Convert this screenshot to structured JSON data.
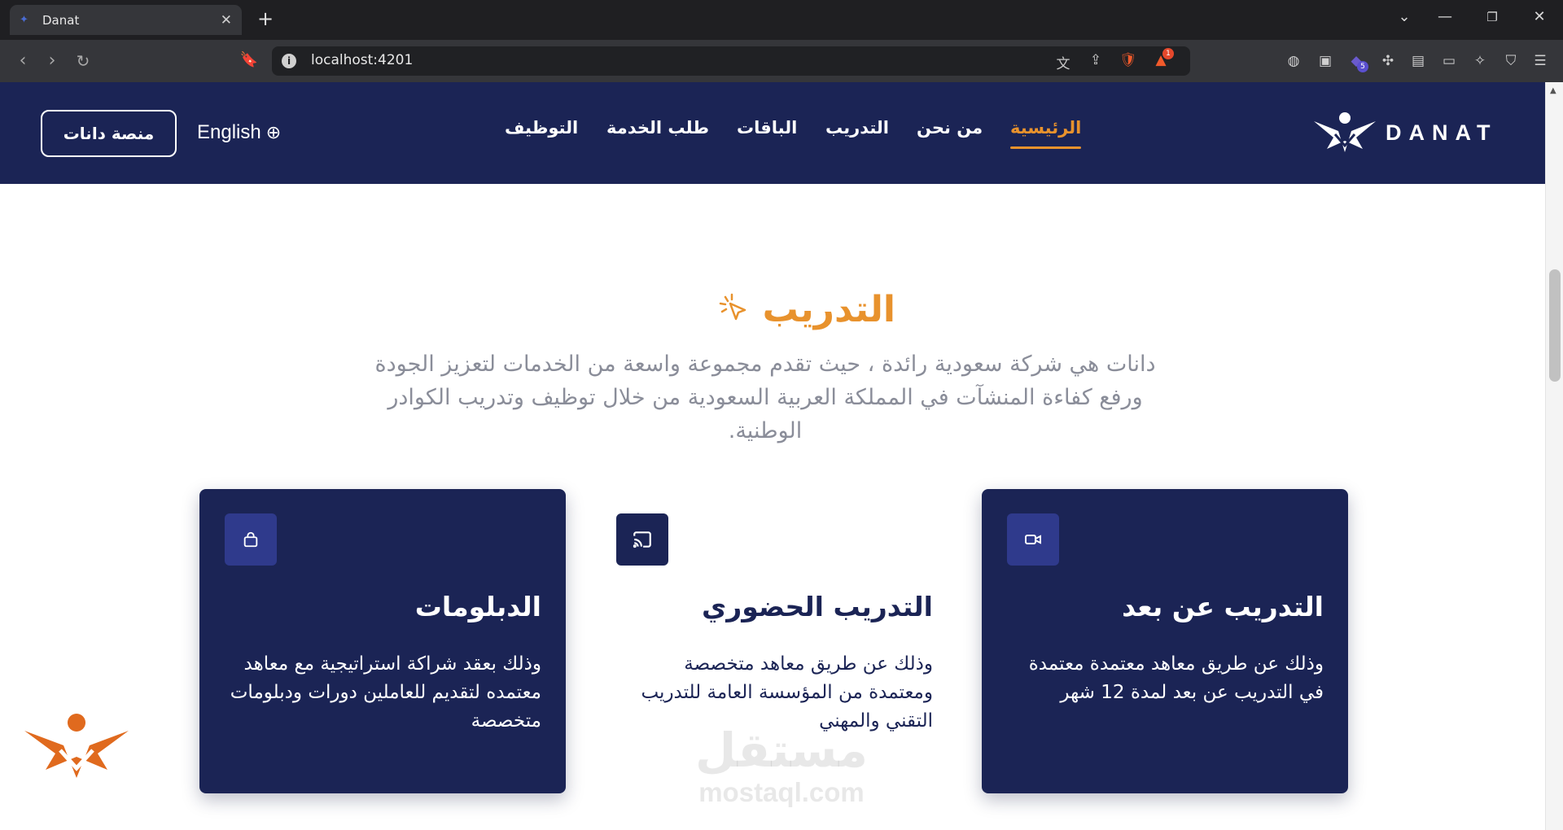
{
  "browser": {
    "tab_title": "Danat",
    "url": "localhost:4201",
    "brave_badge_count": "1",
    "extension_badge_count": "5"
  },
  "header": {
    "logo_text": "DANAT",
    "nav": [
      {
        "label": "الرئيسية",
        "active": true
      },
      {
        "label": "من نحن"
      },
      {
        "label": "التدريب"
      },
      {
        "label": "الباقات"
      },
      {
        "label": "طلب الخدمة"
      },
      {
        "label": "التوظيف"
      }
    ],
    "language_label": "English",
    "platform_button": "منصة دانات"
  },
  "section": {
    "title": "التدريب",
    "intro": "دانات هي شركة سعودية رائدة ، حيث تقدم مجموعة واسعة من الخدمات لتعزيز الجودة ورفع كفاءة المنشآت في المملكة العربية السعودية من خلال توظيف وتدريب الكوادر الوطنية."
  },
  "cards": [
    {
      "icon": "video-camera-icon",
      "title": "التدريب عن بعد",
      "description": "وذلك عن طريق معاهد معتمدة معتمدة في التدريب عن بعد لمدة 12 شهر"
    },
    {
      "icon": "cast-icon",
      "title": "التدريب الحضوري",
      "description": "وذلك عن طريق معاهد متخصصة ومعتمدة من المؤسسة العامة للتدريب التقني والمهني"
    },
    {
      "icon": "shopping-bag-icon",
      "title": "الدبلومات",
      "description": "وذلك بعقد شراكة استراتيجية مع معاهد معتمده لتقديم للعاملين دورات ودبلومات متخصصة"
    }
  ],
  "watermark": {
    "arabic": "مستقل",
    "latin": "mostaql.com"
  },
  "colors": {
    "navy": "#1b2455",
    "orange": "#e8922d",
    "icon_bg": "#2f3a8c"
  }
}
